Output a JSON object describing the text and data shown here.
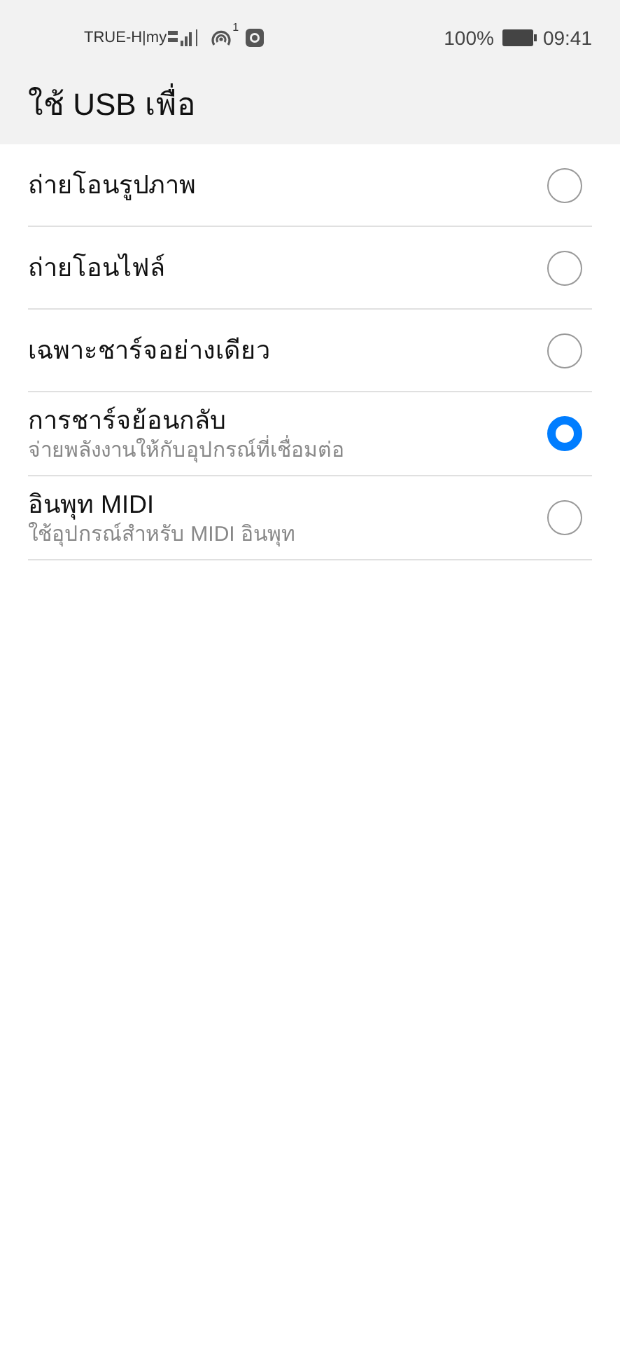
{
  "status_bar": {
    "carrier": "TRUE-H|my",
    "hotspot_count": "1",
    "battery": "100%",
    "time": "09:41"
  },
  "title": "ใช้ USB เพื่อ",
  "options": [
    {
      "label": "ถ่ายโอนรูปภาพ",
      "selected": false
    },
    {
      "label": "ถ่ายโอนไฟล์",
      "selected": false
    },
    {
      "label": "เฉพาะชาร์จอย่างเดียว",
      "selected": false
    },
    {
      "label": "การชาร์จย้อนกลับ",
      "description": "จ่ายพลังงานให้กับอุปกรณ์ที่เชื่อมต่อ",
      "selected": true
    },
    {
      "label": "อินพุท MIDI",
      "description": "ใช้อุปกรณ์สำหรับ MIDI อินพุท",
      "selected": false
    }
  ]
}
